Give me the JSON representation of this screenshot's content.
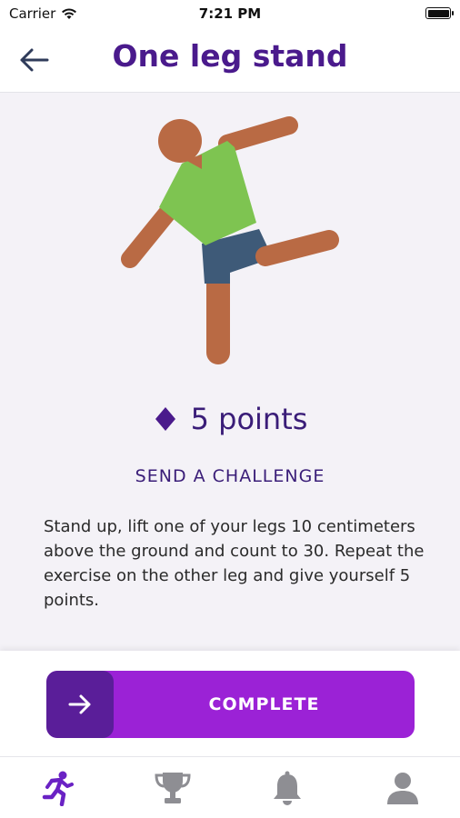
{
  "status_bar": {
    "carrier": "Carrier",
    "time": "7:21 PM"
  },
  "header": {
    "title": "One leg stand"
  },
  "exercise": {
    "points": "5 points",
    "challenge_label": "SEND A CHALLENGE",
    "description": "Stand up, lift one of your legs 10 centimeters above the ground and count to 30. Repeat the exercise on the other leg and give yourself 5 points."
  },
  "action": {
    "complete_label": "COMPLETE"
  },
  "tabs": [
    {
      "icon": "running-icon",
      "active": true
    },
    {
      "icon": "trophy-icon",
      "active": false
    },
    {
      "icon": "bell-icon",
      "active": false
    },
    {
      "icon": "profile-icon",
      "active": false
    }
  ],
  "colors": {
    "title": "#4a1a8c",
    "accent": "#9b22d6",
    "accent_dark": "#5a1e99",
    "background": "#f4f2f7",
    "tab_inactive": "#8e8e93",
    "tab_active": "#6a22c4"
  }
}
